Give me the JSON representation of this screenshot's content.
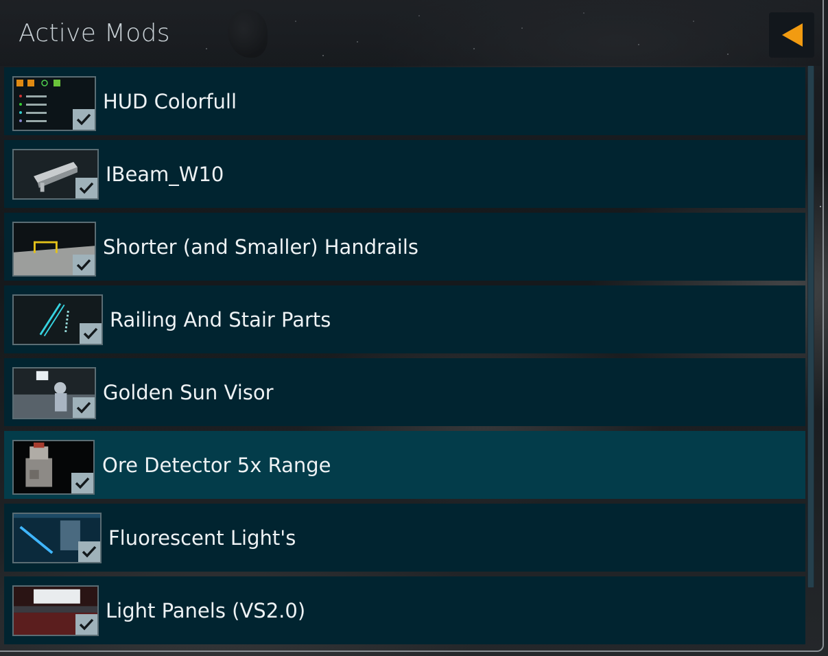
{
  "panel": {
    "title": "Active Mods",
    "back_button": {
      "icon": "triangle-left-icon",
      "accent_color": "#f29b11"
    }
  },
  "mods": [
    {
      "name": "HUD Colorfull",
      "enabled": true,
      "selected": false,
      "thumbnail": "hud-preview"
    },
    {
      "name": "IBeam_W10",
      "enabled": true,
      "selected": false,
      "thumbnail": "ibeam-preview"
    },
    {
      "name": "Shorter (and Smaller) Handrails",
      "enabled": true,
      "selected": false,
      "thumbnail": "handrail-preview"
    },
    {
      "name": "Railing And Stair Parts",
      "enabled": true,
      "selected": false,
      "thumbnail": "railing-preview"
    },
    {
      "name": "Golden Sun Visor",
      "enabled": true,
      "selected": false,
      "thumbnail": "visor-preview"
    },
    {
      "name": "Ore Detector 5x Range",
      "enabled": true,
      "selected": true,
      "thumbnail": "ore-detector-preview"
    },
    {
      "name": "Fluorescent Light's",
      "enabled": true,
      "selected": false,
      "thumbnail": "fluorescent-preview"
    },
    {
      "name": "Light Panels (VS2.0)",
      "enabled": true,
      "selected": false,
      "thumbnail": "light-panels-preview"
    }
  ],
  "colors": {
    "row_background": "#012430",
    "row_selected": "#033c4a",
    "checkbox": "#9fb2ba",
    "text": "#eef2f4",
    "title_text": "#c9d1d6"
  }
}
